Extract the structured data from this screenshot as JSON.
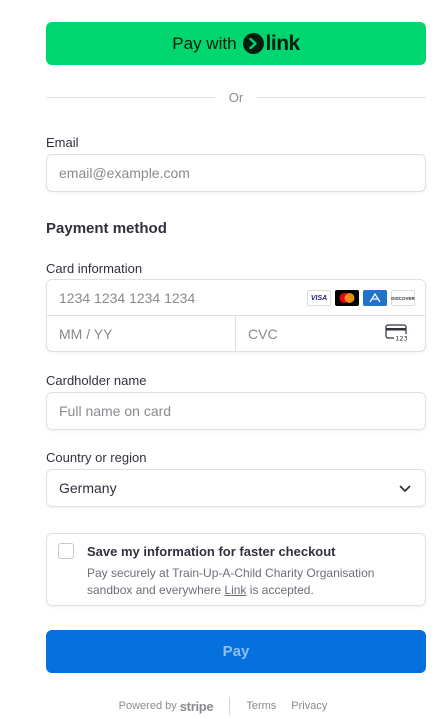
{
  "link_button": {
    "pay_with": "Pay with",
    "brand": "link"
  },
  "divider": {
    "text": "Or"
  },
  "email": {
    "label": "Email",
    "placeholder": "email@example.com"
  },
  "payment": {
    "title": "Payment method",
    "card_label": "Card information",
    "card_number_placeholder": "1234 1234 1234 1234",
    "expiry_placeholder": "MM / YY",
    "cvc_placeholder": "CVC",
    "cvc_icon_text": "123",
    "brands": [
      "VISA",
      "mastercard",
      "amex",
      "DISCOVER"
    ]
  },
  "cardholder": {
    "label": "Cardholder name",
    "placeholder": "Full name on card"
  },
  "country": {
    "label": "Country or region",
    "value": "Germany"
  },
  "save": {
    "title": "Save my information for faster checkout",
    "desc_before": "Pay securely at Train-Up-A-Child Charity Organisation sandbox and everywhere ",
    "desc_link": "Link",
    "desc_after": " is accepted."
  },
  "pay_button": {
    "label": "Pay"
  },
  "footer": {
    "powered_by": "Powered by",
    "stripe": "stripe",
    "terms": "Terms",
    "privacy": "Privacy"
  },
  "colors": {
    "link_green": "#00d66f",
    "pay_blue": "#0570de",
    "text": "#30313d",
    "muted": "#8a8a8f"
  }
}
